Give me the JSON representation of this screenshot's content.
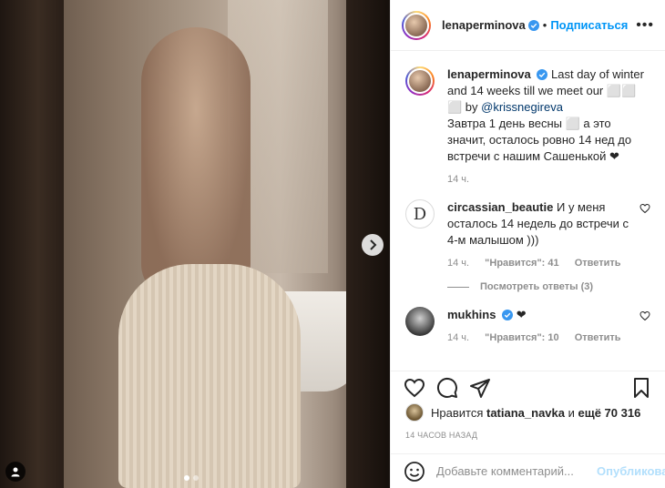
{
  "post": {
    "author": "lenaperminova",
    "follow_label": "Подписаться",
    "separator": "•",
    "more_label": "•••"
  },
  "caption": {
    "username": "lenaperminova",
    "text_en": "Last day of winter and 14 weeks till we meet our ⬜⬜ ⬜ by ",
    "mention": "@krissnegireva",
    "text_ru": "Завтра 1 день весны ⬜ а это значит, осталось ровно 14 нед до встречи с нашим Сашенькой ❤",
    "time": "14 ч."
  },
  "comments": [
    {
      "username": "circassian_beautie",
      "text": "И у меня осталось 14 недель до встречи с 4-м малышом )))",
      "time": "14 ч.",
      "likes": "\"Нравится\": 41",
      "reply": "Ответить",
      "view_replies": "Посмотреть ответы (3)",
      "avatar_letter": "D"
    },
    {
      "username": "mukhins",
      "text": "❤",
      "time": "14 ч.",
      "likes": "\"Нравится\": 10",
      "reply": "Ответить"
    }
  ],
  "likes": {
    "prefix": "Нравится",
    "user": "tatiana_navka",
    "and": "и",
    "count": "ещё 70 316"
  },
  "timestamp": "14 ЧАСОВ НАЗАД",
  "add_comment": {
    "placeholder": "Добавьте комментарий...",
    "post_label": "Опубликовать"
  },
  "colors": {
    "accent": "#0095f6",
    "verified": "#3897f0",
    "post_disabled": "#b2dffc"
  },
  "carousel": {
    "slides": 2,
    "active": 1
  }
}
